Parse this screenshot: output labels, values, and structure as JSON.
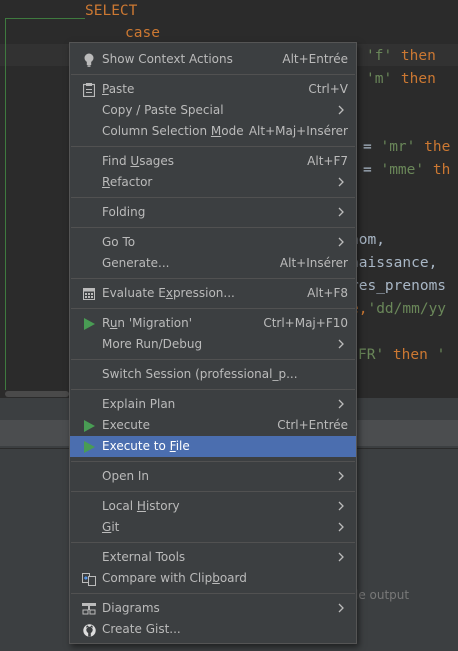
{
  "editor": {
    "lines": [
      {
        "segments": [
          {
            "t": "SELECT",
            "c": "kw"
          }
        ]
      },
      {
        "segments": [
          {
            "t": "case",
            "c": "kw"
          }
        ]
      },
      {
        "segments": [
          {
            "t": "'f'",
            "c": "str"
          },
          {
            "t": " then",
            "c": "kw"
          }
        ]
      },
      {
        "segments": [
          {
            "t": "'m'",
            "c": "str"
          },
          {
            "t": " then",
            "c": "kw"
          }
        ]
      },
      {
        "segments": [
          {
            "t": "= ",
            "c": "plain"
          },
          {
            "t": "'mr'",
            "c": "str"
          },
          {
            "t": " the",
            "c": "kw"
          }
        ]
      },
      {
        "segments": [
          {
            "t": "= ",
            "c": "plain"
          },
          {
            "t": "'mme'",
            "c": "str"
          },
          {
            "t": " th",
            "c": "kw"
          }
        ]
      },
      {
        "segments": [
          {
            "t": "nom,",
            "c": "plain"
          }
        ]
      },
      {
        "segments": [
          {
            "t": "naissance,",
            "c": "plain"
          }
        ]
      },
      {
        "segments": [
          {
            "t": "res_prenoms",
            "c": "plain"
          }
        ]
      },
      {
        "segments": [
          {
            "t": "e,",
            "c": "kw"
          },
          {
            "t": "'dd/mm/yy",
            "c": "str"
          }
        ]
      },
      {
        "segments": [
          {
            "t": "FR'",
            "c": "str"
          },
          {
            "t": " then ",
            "c": "kw"
          },
          {
            "t": "'",
            "c": "str"
          }
        ]
      }
    ]
  },
  "bottom_panel": {
    "text": "le output"
  },
  "menu": {
    "items": [
      {
        "name": "show-context-actions",
        "icon": "lightbulb-icon",
        "label": "Show Context Actions",
        "u": "",
        "shortcut": "Alt+Entrée"
      },
      {
        "sep": true
      },
      {
        "name": "paste",
        "icon": "clipboard-icon",
        "label": "Paste",
        "u": "P",
        "shortcut": "Ctrl+V"
      },
      {
        "name": "copy-paste-special",
        "label": "Copy / Paste Special",
        "submenu": true
      },
      {
        "name": "column-selection-mode",
        "label": "Column Selection Mode",
        "u": "M",
        "shortcut": "Alt+Maj+Insérer"
      },
      {
        "sep": true
      },
      {
        "name": "find-usages",
        "label": "Find Usages",
        "u": "U",
        "shortcut": "Alt+F7"
      },
      {
        "name": "refactor",
        "label": "Refactor",
        "u": "R",
        "submenu": true
      },
      {
        "sep": true
      },
      {
        "name": "folding",
        "label": "Folding",
        "submenu": true
      },
      {
        "sep": true
      },
      {
        "name": "go-to",
        "label": "Go To",
        "submenu": true
      },
      {
        "name": "generate",
        "label": "Generate...",
        "shortcut": "Alt+Insérer"
      },
      {
        "sep": true
      },
      {
        "name": "evaluate-expression",
        "icon": "calculator-icon",
        "label": "Evaluate Expression...",
        "u": "x",
        "shortcut": "Alt+F8"
      },
      {
        "sep": true
      },
      {
        "name": "run-migration",
        "icon": "run-icon",
        "label": "Run 'Migration'",
        "u": "u",
        "shortcut": "Ctrl+Maj+F10"
      },
      {
        "name": "more-run-debug",
        "label": "More Run/Debug",
        "submenu": true
      },
      {
        "sep": true
      },
      {
        "name": "switch-session",
        "label": "Switch Session (professional_p..."
      },
      {
        "sep": true
      },
      {
        "name": "explain-plan",
        "label": "Explain Plan",
        "submenu": true
      },
      {
        "name": "execute",
        "icon": "run-icon",
        "label": "Execute",
        "shortcut": "Ctrl+Entrée"
      },
      {
        "name": "execute-to-file",
        "icon": "run-icon",
        "label": "Execute to File",
        "u": "F",
        "selected": true
      },
      {
        "sep": true
      },
      {
        "name": "open-in",
        "label": "Open In",
        "submenu": true
      },
      {
        "sep": true
      },
      {
        "name": "local-history",
        "label": "Local History",
        "u": "H",
        "submenu": true
      },
      {
        "name": "git",
        "label": "Git",
        "u": "G",
        "submenu": true
      },
      {
        "sep": true
      },
      {
        "name": "external-tools",
        "label": "External Tools",
        "submenu": true
      },
      {
        "name": "compare-with-clipboard",
        "icon": "compare-icon",
        "label": "Compare with Clipboard",
        "u": "b"
      },
      {
        "sep": true
      },
      {
        "name": "diagrams",
        "icon": "diagram-icon",
        "label": "Diagrams",
        "submenu": true
      },
      {
        "name": "create-gist",
        "icon": "github-icon",
        "label": "Create Gist..."
      }
    ]
  },
  "colors": {
    "run_icon": "#499c54",
    "selection": "#4b6eaf",
    "keyword": "#cc7832",
    "string": "#6a8759"
  }
}
